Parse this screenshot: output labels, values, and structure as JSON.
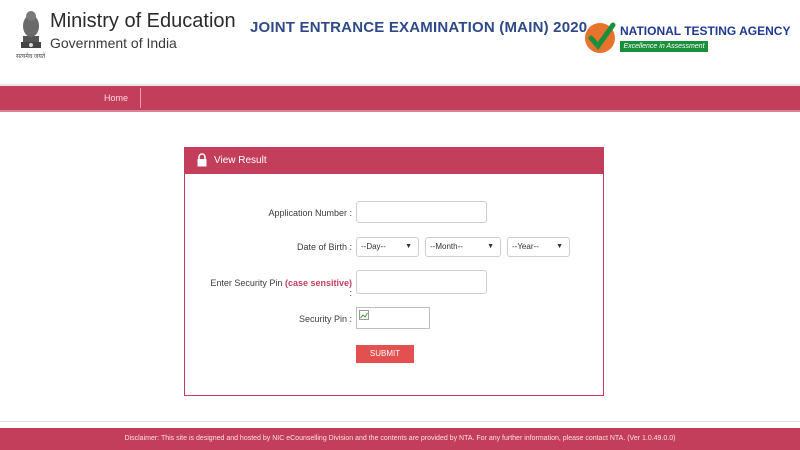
{
  "header": {
    "ministry_title": "Ministry of Education",
    "ministry_subtitle": "Government of India",
    "emblem_caption": "सत्यमेव जयते",
    "exam_title": "JOINT ENTRANCE EXAMINATION (MAIN) 2020",
    "agency_name": "NATIONAL TESTING AGENCY",
    "agency_tagline": "Excellence in Assessment"
  },
  "nav": {
    "home_label": "Home"
  },
  "panel": {
    "title": "View Result",
    "application_number_label": "Application Number :",
    "dob_label": "Date of Birth :",
    "dob_day": "--Day--",
    "dob_month": "--Month--",
    "dob_year": "--Year--",
    "security_pin_label": "Enter Security Pin",
    "case_sensitive": "(case sensitive)",
    "colon": " :",
    "captcha_label": "Security Pin :",
    "submit_label": "SUBMIT"
  },
  "footer": {
    "disclaimer": "Disclaimer: This site is designed and hosted by NIC eCounselling Division and the contents are provided by NTA. For any further information, please contact NTA. (Ver 1.0.49.0.0)"
  },
  "colors": {
    "brand": "#c23e5b",
    "submit": "#e2504f",
    "title_blue": "#2f4a86",
    "nta_green": "#1a8f3c"
  }
}
